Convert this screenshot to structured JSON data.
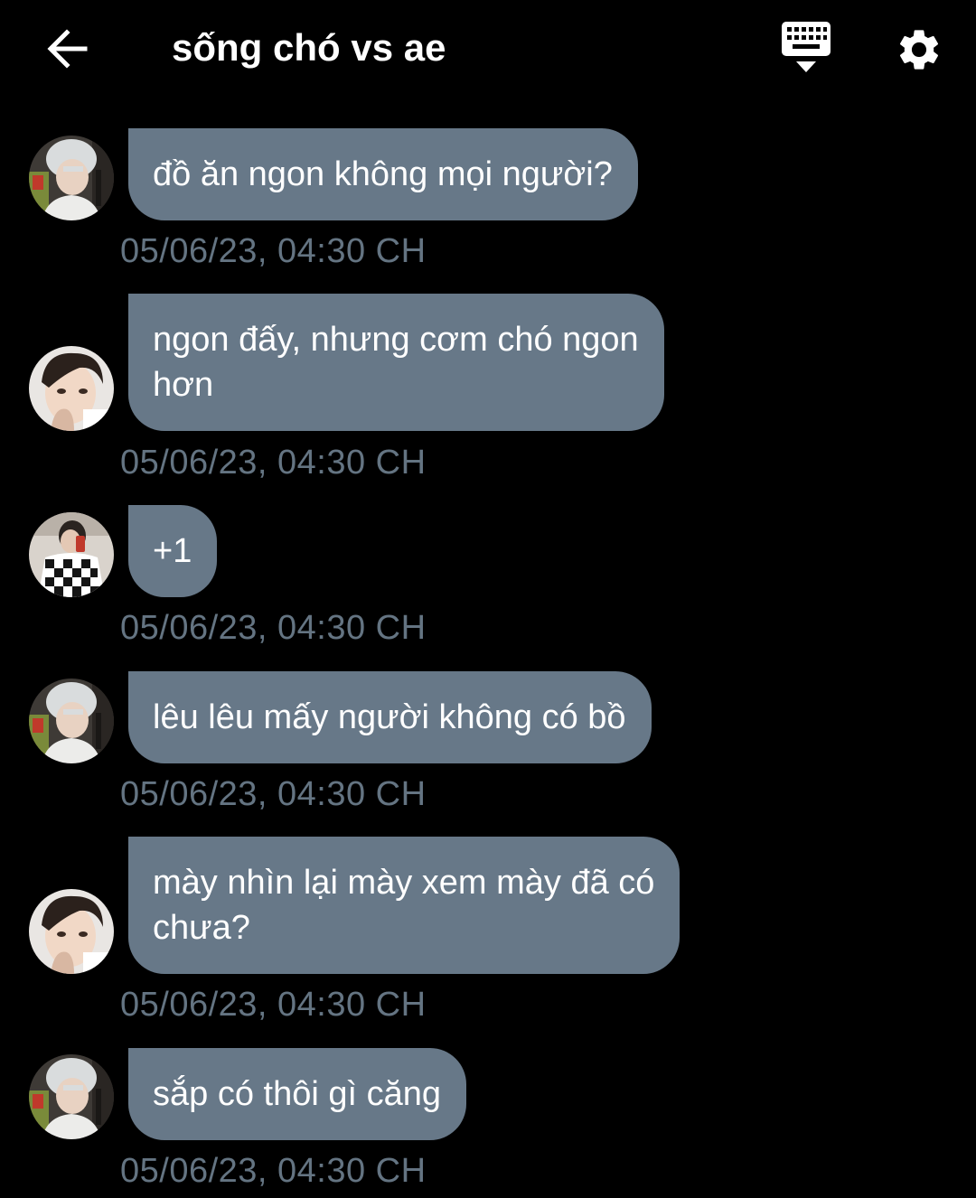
{
  "header": {
    "title": "sống chó vs ae",
    "back_icon": "arrow-left-icon",
    "keyboard_icon": "keyboard-icon",
    "settings_icon": "gear-icon"
  },
  "colors": {
    "background": "#000000",
    "bubble": "#677888",
    "timestamp": "#647482",
    "text": "#ffffff"
  },
  "messages": [
    {
      "avatar": "user-silver-hair-avatar",
      "text": "đồ ăn ngon không mọi người?",
      "time": "05/06/23, 04:30 CH"
    },
    {
      "avatar": "user-dark-hair-avatar",
      "text": "ngon đấy, nhưng cơm chó ngon\nhơn",
      "time": "05/06/23, 04:30 CH"
    },
    {
      "avatar": "user-mirror-selfie-avatar",
      "text": "+1",
      "time": "05/06/23, 04:30 CH"
    },
    {
      "avatar": "user-silver-hair-avatar",
      "text": "lêu lêu mấy người không có bồ",
      "time": "05/06/23, 04:30 CH"
    },
    {
      "avatar": "user-dark-hair-avatar",
      "text": "mày nhìn lại mày xem mày đã có\nchưa?",
      "time": "05/06/23, 04:30 CH"
    },
    {
      "avatar": "user-silver-hair-avatar",
      "text": "sắp có thôi gì căng",
      "time": "05/06/23, 04:30 CH"
    }
  ]
}
